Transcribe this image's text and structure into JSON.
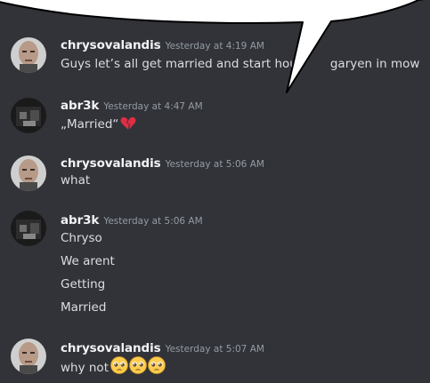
{
  "messages": [
    {
      "username": "chrysovalandis",
      "timestamp": "Yesterday at 4:19 AM",
      "lines": [
        "Guys let’s all get married and start hous",
        "garyen in mow"
      ]
    },
    {
      "username": "abr3k",
      "timestamp": "Yesterday at 4:47 AM",
      "lines": [
        "„Married“"
      ]
    },
    {
      "username": "chrysovalandis",
      "timestamp": "Yesterday at 5:06 AM",
      "lines": [
        "what"
      ]
    },
    {
      "username": "abr3k",
      "timestamp": "Yesterday at 5:06 AM",
      "lines": [
        "Chryso",
        "We arent",
        "Getting",
        "Married"
      ]
    },
    {
      "username": "chrysovalandis",
      "timestamp": "Yesterday at 5:07 AM",
      "lines": [
        "why not"
      ]
    }
  ],
  "icons": {
    "broken_heart": "broken-heart-icon",
    "pleading_face": "pleading-face-icon"
  },
  "colors": {
    "background": "#313338",
    "username": "#f2f3f5",
    "timestamp": "#949ba4",
    "text": "#dbdee1"
  }
}
